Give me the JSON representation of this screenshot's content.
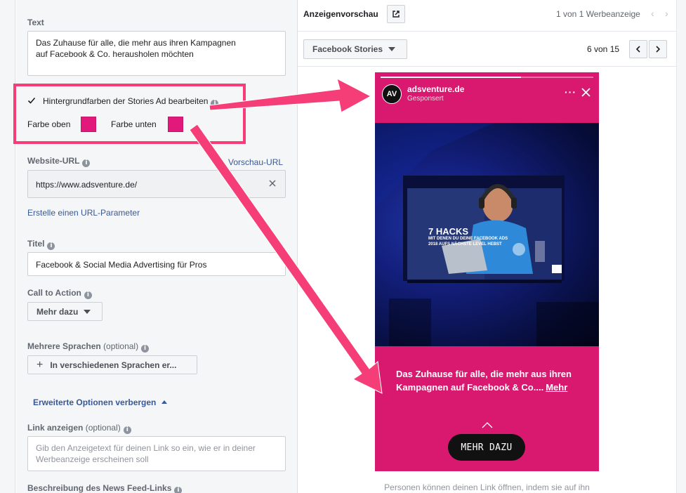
{
  "left": {
    "text_label": "Text",
    "text_value_line1": "Das Zuhause für alle, die mehr aus ihren Kampagnen",
    "text_value_line2": "auf Facebook & Co. herausholen möchten",
    "bg_checkbox_label": "Hintergrundfarben der Stories Ad bearbeiten",
    "bg_checked": true,
    "color_top_label": "Farbe oben",
    "color_bottom_label": "Farbe unten",
    "color_top": "#e0197a",
    "color_bottom": "#e0197a",
    "website_url_label": "Website-URL",
    "preview_url_link": "Vorschau-URL",
    "website_url_value": "https://www.adsventure.de/",
    "url_param_link": "Erstelle einen URL-Parameter",
    "title_label": "Titel",
    "title_value": "Facebook & Social Media Advertising für Pros",
    "cta_label": "Call to Action",
    "cta_value": "Mehr dazu",
    "languages_label": "Mehrere Sprachen",
    "languages_optional": "(optional)",
    "languages_button": "In verschiedenen Sprachen er...",
    "advanced_toggle": "Erweiterte Optionen verbergen",
    "display_link_label": "Link anzeigen",
    "display_link_optional": "(optional)",
    "display_link_placeholder_line1": "Gib den Anzeigetext für deinen Link so ein, wie er in deiner",
    "display_link_placeholder_line2": "Werbeanzeige erscheinen soll",
    "newsfeed_desc_label": "Beschreibung des News Feed-Links"
  },
  "right": {
    "title": "Anzeigenvorschau",
    "ad_count": "1 von 1 Werbeanzeige",
    "placement": "Facebook Stories",
    "placement_index": "6 von 15",
    "story": {
      "avatar_text": "AV",
      "page_name": "adsventure.de",
      "sponsored": "Gesponsert",
      "image_headline": "7 HACKS",
      "image_subline1": "MIT DENEN DU DEINE FACEBOOK ADS",
      "image_subline2": "2018 AUFS NÄCHSTE LEVEL HEBST",
      "caption": "Das Zuhause für alle, die mehr aus ihren Kampagnen auf Facebook & Co....",
      "more": "Mehr",
      "cta": "MEHR DAZU",
      "progress": 0.66,
      "background_color": "#d8196f"
    },
    "bottom_note": "Personen können deinen Link öffnen, indem sie auf ihn"
  },
  "annotation": {
    "highlight_color": "#f53d78"
  }
}
